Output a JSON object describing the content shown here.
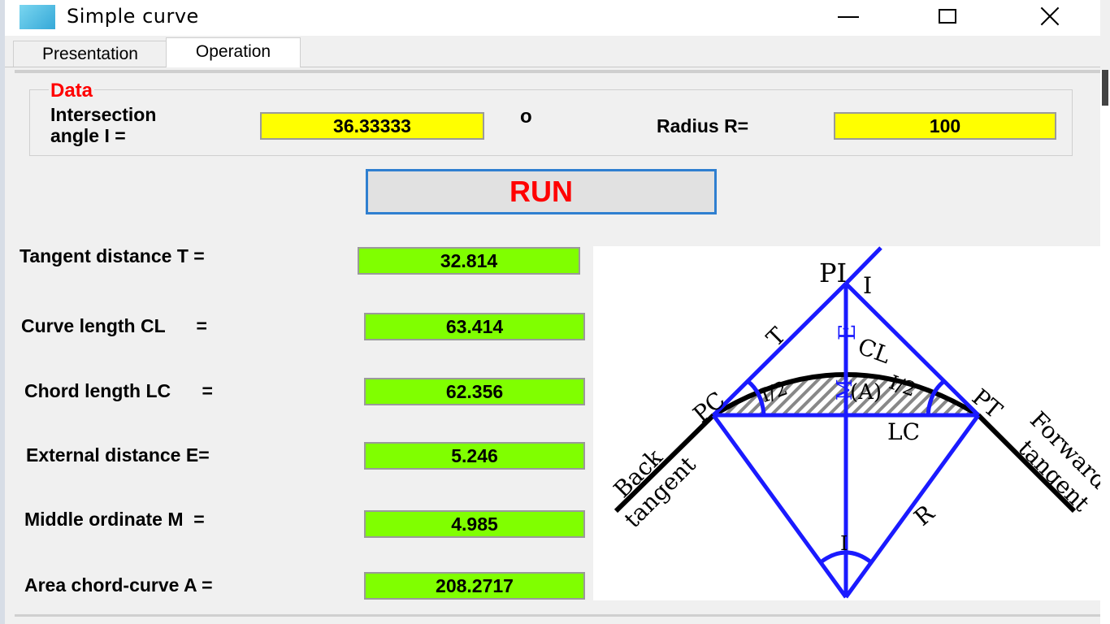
{
  "window": {
    "title": "Simple curve"
  },
  "tabs": [
    {
      "label": "Presentation"
    },
    {
      "label": "Operation"
    }
  ],
  "data_group": {
    "label": "Data",
    "angle_label_line1": "Intersection",
    "angle_label_line2": "angle I =",
    "angle_value": "36.33333",
    "degree_symbol": "o",
    "radius_label": "Radius R=",
    "radius_value": "100"
  },
  "run_button": {
    "label": "RUN"
  },
  "results": [
    {
      "label": "Tangent distance T =",
      "value": "32.814"
    },
    {
      "label": "Curve length CL      =",
      "value": "63.414"
    },
    {
      "label": "Chord length LC      =",
      "value": "62.356"
    },
    {
      "label": "External distance E=",
      "value": "5.246"
    },
    {
      "label": "Middle ordinate M  =",
      "value": "4.985"
    },
    {
      "label": "Area chord-curve A =",
      "value": "208.2717"
    }
  ],
  "diagram": {
    "labels": {
      "pi": "PI",
      "i_top": "I",
      "t": "T",
      "e": "E",
      "cl": "CL",
      "m": "M",
      "a": "(A)",
      "half_left": "I/2",
      "half_right": "I/2",
      "pc": "PC",
      "pt": "PT",
      "lc": "LC",
      "back": "Back",
      "back_tangent": "tangent",
      "forward": "Forward",
      "forward_tangent": "tangent",
      "r": "R",
      "i_bottom": "I"
    },
    "colors": {
      "lines": "#1a1aff",
      "curve": "#000000",
      "hatch": "#888888"
    }
  }
}
